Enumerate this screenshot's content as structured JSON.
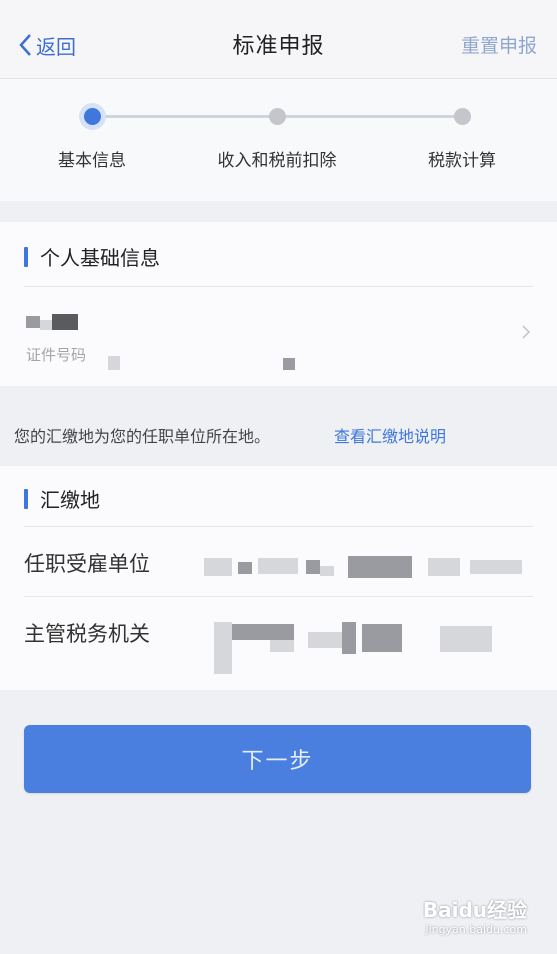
{
  "navbar": {
    "back_label": "返回",
    "title": "标准申报",
    "reset_label": "重置申报"
  },
  "steps": [
    {
      "label": "基本信息",
      "active": true
    },
    {
      "label": "收入和税前扣除",
      "active": false
    },
    {
      "label": "税款计算",
      "active": false
    }
  ],
  "personal": {
    "section_title": "个人基础信息",
    "id_label": "证件号码"
  },
  "notice": {
    "text": "您的汇缴地为您的任职单位所在地。",
    "link": "查看汇缴地说明"
  },
  "filing": {
    "section_title": "汇缴地",
    "employer_label": "任职受雇单位",
    "tax_authority_label": "主管税务机关"
  },
  "next_button": "下一步",
  "watermark": {
    "logo": "Baidu经验",
    "url": "jingyan.baidu.com"
  },
  "colors": {
    "accent": "#3f77dc",
    "button": "#4a7fe0"
  }
}
